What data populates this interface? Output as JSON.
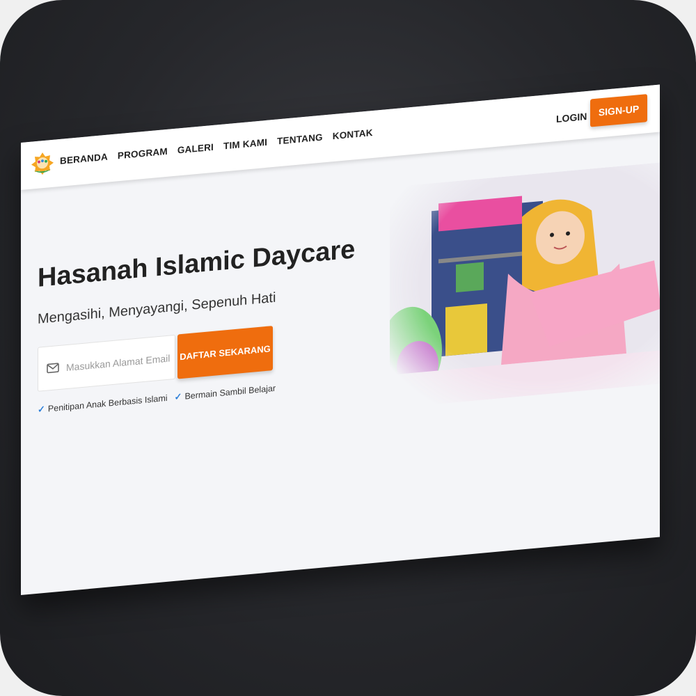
{
  "nav": {
    "items": [
      "BERANDA",
      "PROGRAM",
      "GALERI",
      "TIM KAMI",
      "TENTANG",
      "KONTAK"
    ],
    "login_label": "LOGIN",
    "signup_label": "SIGN-UP"
  },
  "hero": {
    "title": "Hasanah Islamic Daycare",
    "subtitle": "Mengasihi, Menyayangi, Sepenuh Hati",
    "email_placeholder": "Masukkan Alamat Email",
    "email_value": "",
    "cta_label": "DAFTAR SEKARANG",
    "features": [
      "Penitipan Anak Berbasis Islami",
      "Bermain Sambil Belajar"
    ]
  },
  "icons": {
    "logo": "daycare-logo",
    "email": "mail-icon",
    "feature": "check-icon"
  },
  "colors": {
    "accent": "#ef6d0e",
    "page_bg": "#f4f5f8",
    "check": "#2a7ed8"
  }
}
